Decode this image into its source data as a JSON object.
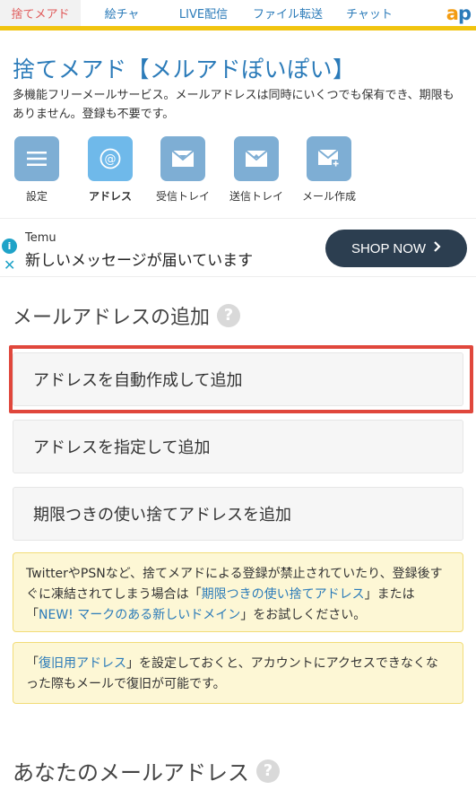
{
  "nav": {
    "tabs": [
      "捨てメアド",
      "絵チャ",
      "LIVE配信",
      "ファイル転送",
      "チャット"
    ],
    "logo_a": "a",
    "logo_p": "p"
  },
  "header": {
    "title": "捨てメアド【メルアドぽいぽい】",
    "description": "多機能フリーメールサービス。メールアドレスは同時にいくつでも保有でき、期限もありません。登録も不要です。"
  },
  "icon_buttons": [
    {
      "label": "設定",
      "icon": "menu-icon"
    },
    {
      "label": "アドレス",
      "icon": "at-icon"
    },
    {
      "label": "受信トレイ",
      "icon": "inbox-icon"
    },
    {
      "label": "送信トレイ",
      "icon": "outbox-icon"
    },
    {
      "label": "メール作成",
      "icon": "compose-icon"
    }
  ],
  "ad": {
    "brand": "Temu",
    "message": "新しいメッセージが届いています",
    "cta": "SHOP NOW"
  },
  "section_add": {
    "heading": "メールアドレスの追加",
    "buttons": [
      "アドレスを自動作成して追加",
      "アドレスを指定して追加",
      "期限つきの使い捨てアドレスを追加"
    ]
  },
  "notes": {
    "note1_pre": "TwitterやPSNなど、捨てメアドによる登録が禁止されていたり、登録後すぐに凍結されてしまう場合は「",
    "note1_link1": "期限つきの使い捨てアドレス",
    "note1_mid": "」または「",
    "note1_link2": "NEW! マークのある新しいドメイン",
    "note1_post": "」をお試しください。",
    "note2_pre": "「",
    "note2_link": "復旧用アドレス",
    "note2_post": "」を設定しておくと、アカウントにアクセスできなくなった際もメールで復旧が可能です。"
  },
  "section_yours": {
    "heading": "あなたのメールアドレス"
  },
  "colors": {
    "accent_blue": "#2b7bb9",
    "nav_bar_yellow": "#f1c40f",
    "highlight_red": "#e0473c"
  }
}
